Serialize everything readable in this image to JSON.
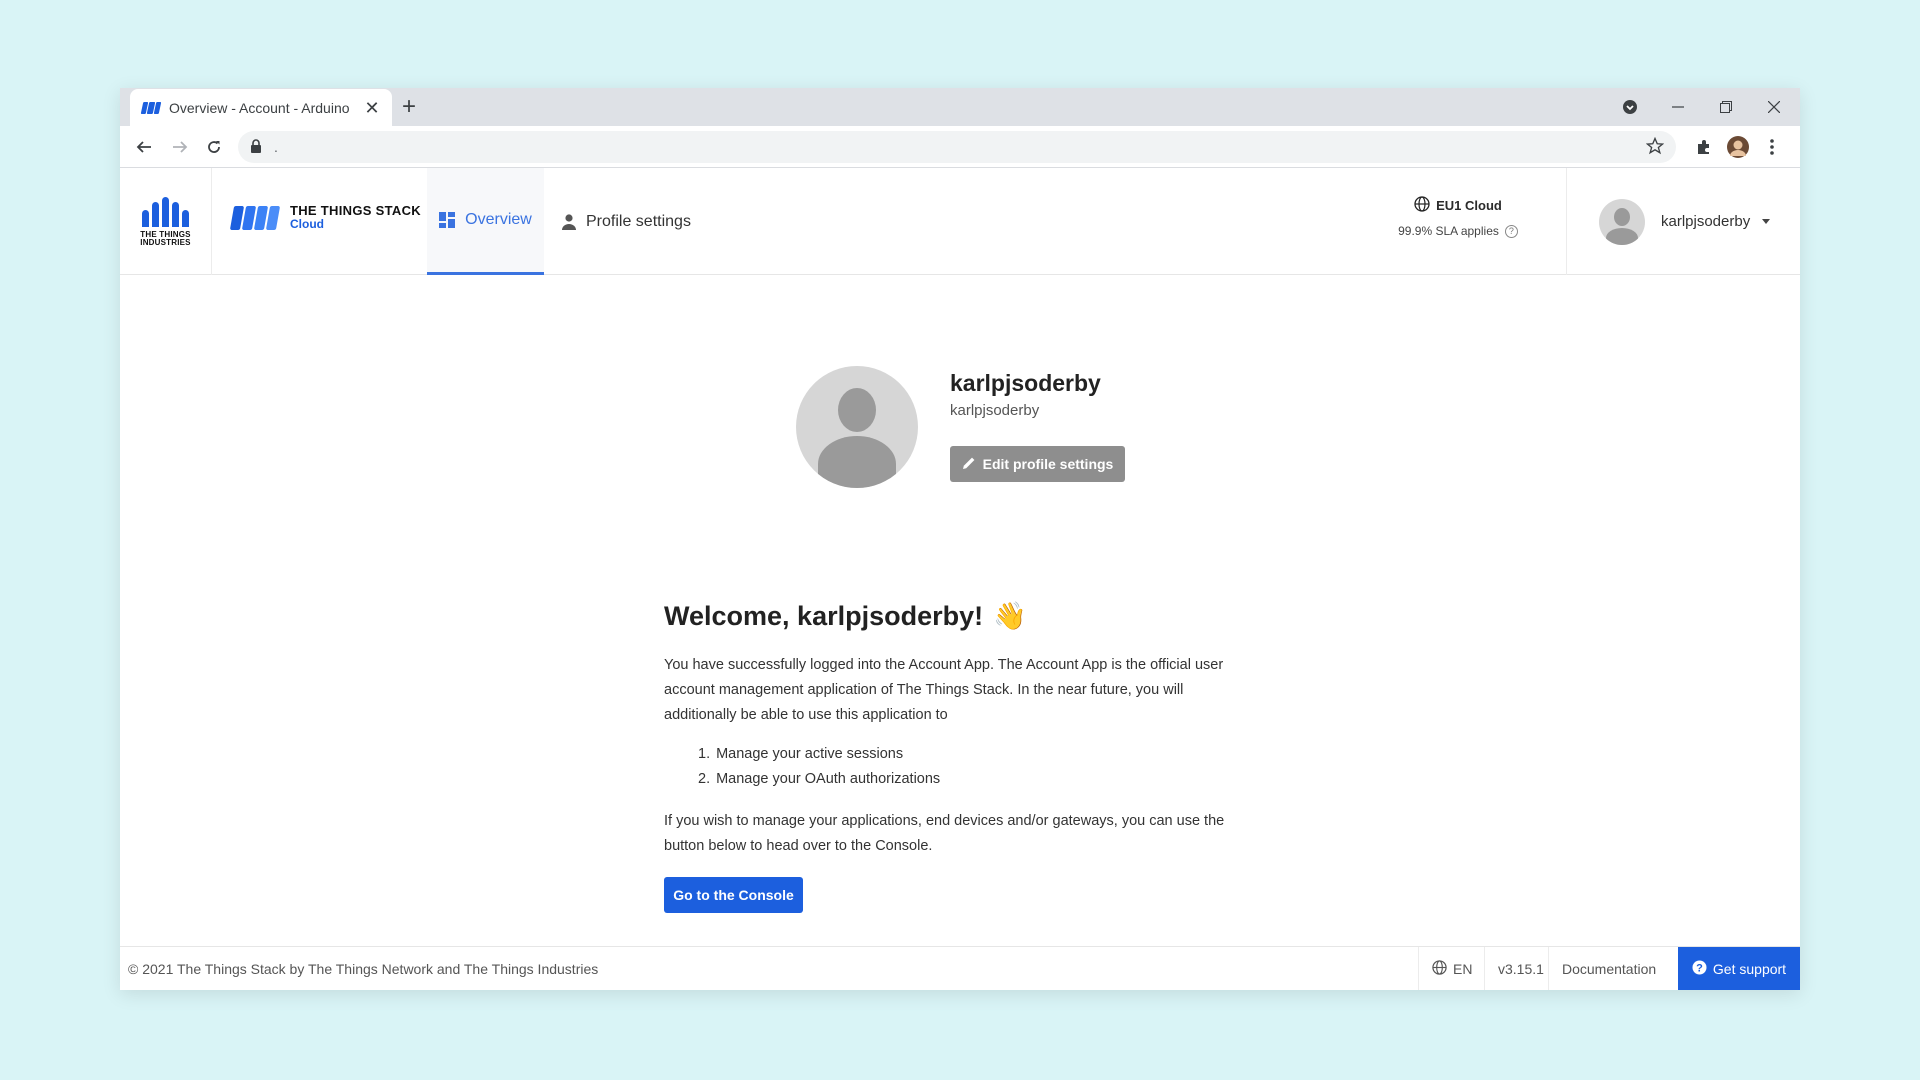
{
  "browser": {
    "tab_title": "Overview - Account - Arduino",
    "tab_close": "✕",
    "new_tab": "+",
    "address": "."
  },
  "header": {
    "tti_logo_line1": "THE THINGS",
    "tti_logo_line2": "INDUSTRIES",
    "tts_name": "THE THINGS STACK",
    "tts_sub": "Cloud",
    "nav": [
      {
        "label": "Overview",
        "icon": "dashboard-icon",
        "active": true
      },
      {
        "label": "Profile settings",
        "icon": "person-icon",
        "active": false
      }
    ],
    "region": "EU1 Cloud",
    "sla": "99.9% SLA applies",
    "username": "karlpjsoderby"
  },
  "profile": {
    "name": "karlpjsoderby",
    "handle": "karlpjsoderby",
    "edit_label": "Edit profile settings"
  },
  "welcome": {
    "title": "Welcome, karlpjsoderby!",
    "emoji": "👋",
    "intro": "You have successfully logged into the Account App. The Account App is the official user account management application of The Things Stack. In the near future, you will additionally be able to use this application to",
    "list": [
      {
        "num": "1.",
        "text": "Manage your active sessions"
      },
      {
        "num": "2.",
        "text": "Manage your OAuth authorizations"
      }
    ],
    "outro": "If you wish to manage your applications, end devices and/or gateways, you can use the button below to head over to the Console.",
    "console_label": "Go to the Console"
  },
  "footer": {
    "copyright": "© 2021 The Things Stack by The Things Network and The Things Industries",
    "language": "EN",
    "version": "v3.15.1",
    "docs": "Documentation",
    "support": "Get support"
  },
  "colors": {
    "brand": "#1c5fde",
    "active_tab": "#3a73e0",
    "page_background": "#d9f4f6",
    "edit_button": "#8e8e8e"
  }
}
